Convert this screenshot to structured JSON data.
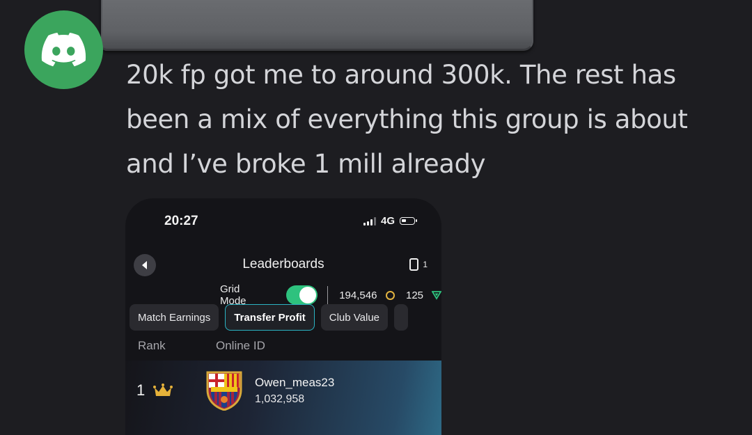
{
  "message": {
    "text": "20k fp got me to around 300k. The rest has been a mix of everything this group is about and I’ve broke 1 mill already"
  },
  "avatar": {
    "icon": "discord-logo-icon",
    "color": "#3ba55d"
  },
  "phone": {
    "status": {
      "time": "20:27",
      "network": "4G"
    },
    "header": {
      "title": "Leaderboards",
      "count": "1"
    },
    "grid_mode": {
      "label": "Grid Mode",
      "on": true
    },
    "currency": {
      "coins": "194,546",
      "points": "125"
    },
    "tabs": [
      "Match Earnings",
      "Transfer Profit",
      "Club Value"
    ],
    "active_tab": "Transfer Profit",
    "columns": {
      "rank": "Rank",
      "online_id": "Online ID"
    },
    "rows": [
      {
        "rank": "1",
        "name": "Owen_meas23",
        "value": "1,032,958",
        "club_badge": "FCB"
      }
    ]
  },
  "colors": {
    "toggle_on": "#2ec27e",
    "active_tab_border": "#2bb4c4",
    "crown": "#e6b23a"
  }
}
